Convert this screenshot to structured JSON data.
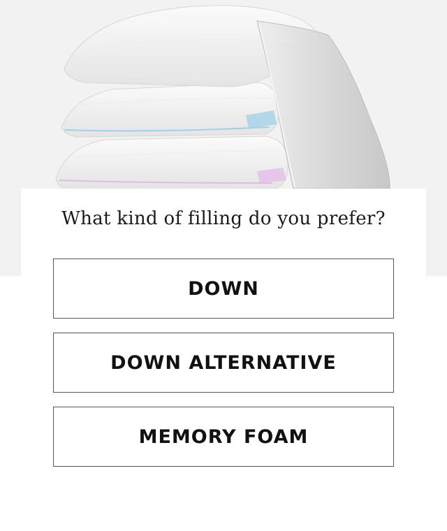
{
  "quiz": {
    "question": "What kind of filling do you prefer?",
    "options": [
      {
        "label": "DOWN"
      },
      {
        "label": "DOWN ALTERNATIVE"
      },
      {
        "label": "MEMORY FOAM"
      }
    ]
  },
  "hero": {
    "image": "stacked-pillows-photo",
    "colors": {
      "background": "#f2f2f2",
      "pillow": "#f7f7f7",
      "piping_blue": "#9fd0e8",
      "piping_pink": "#e3b8e6"
    }
  }
}
